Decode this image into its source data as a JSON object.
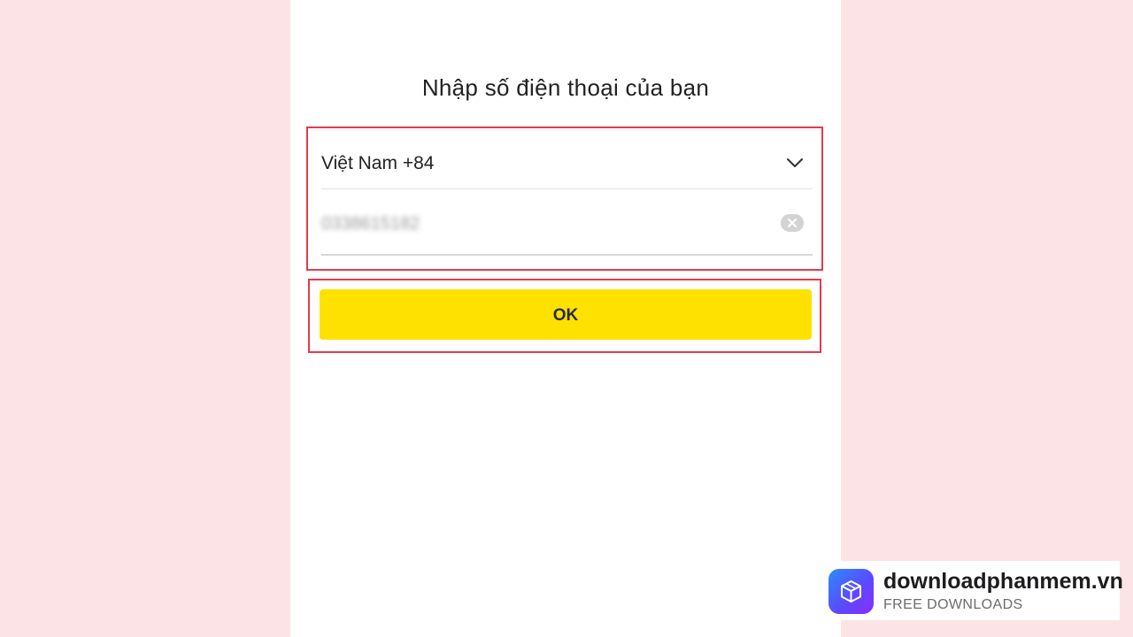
{
  "screen": {
    "title": "Nhập số điện thoại của bạn"
  },
  "form": {
    "country_label": "Việt Nam +84",
    "country_icon": "chevron-down-icon",
    "phone_value": "0338615182",
    "clear_icon": "clear-icon"
  },
  "actions": {
    "ok_label": "OK"
  },
  "watermark": {
    "name": "downloadphanmem.vn",
    "tagline": "FREE DOWNLOADS",
    "logo_icon": "box-icon"
  },
  "colors": {
    "accent_yellow": "#ffe100",
    "highlight_red": "#e53a4b",
    "background_pink": "#fce4e6"
  }
}
